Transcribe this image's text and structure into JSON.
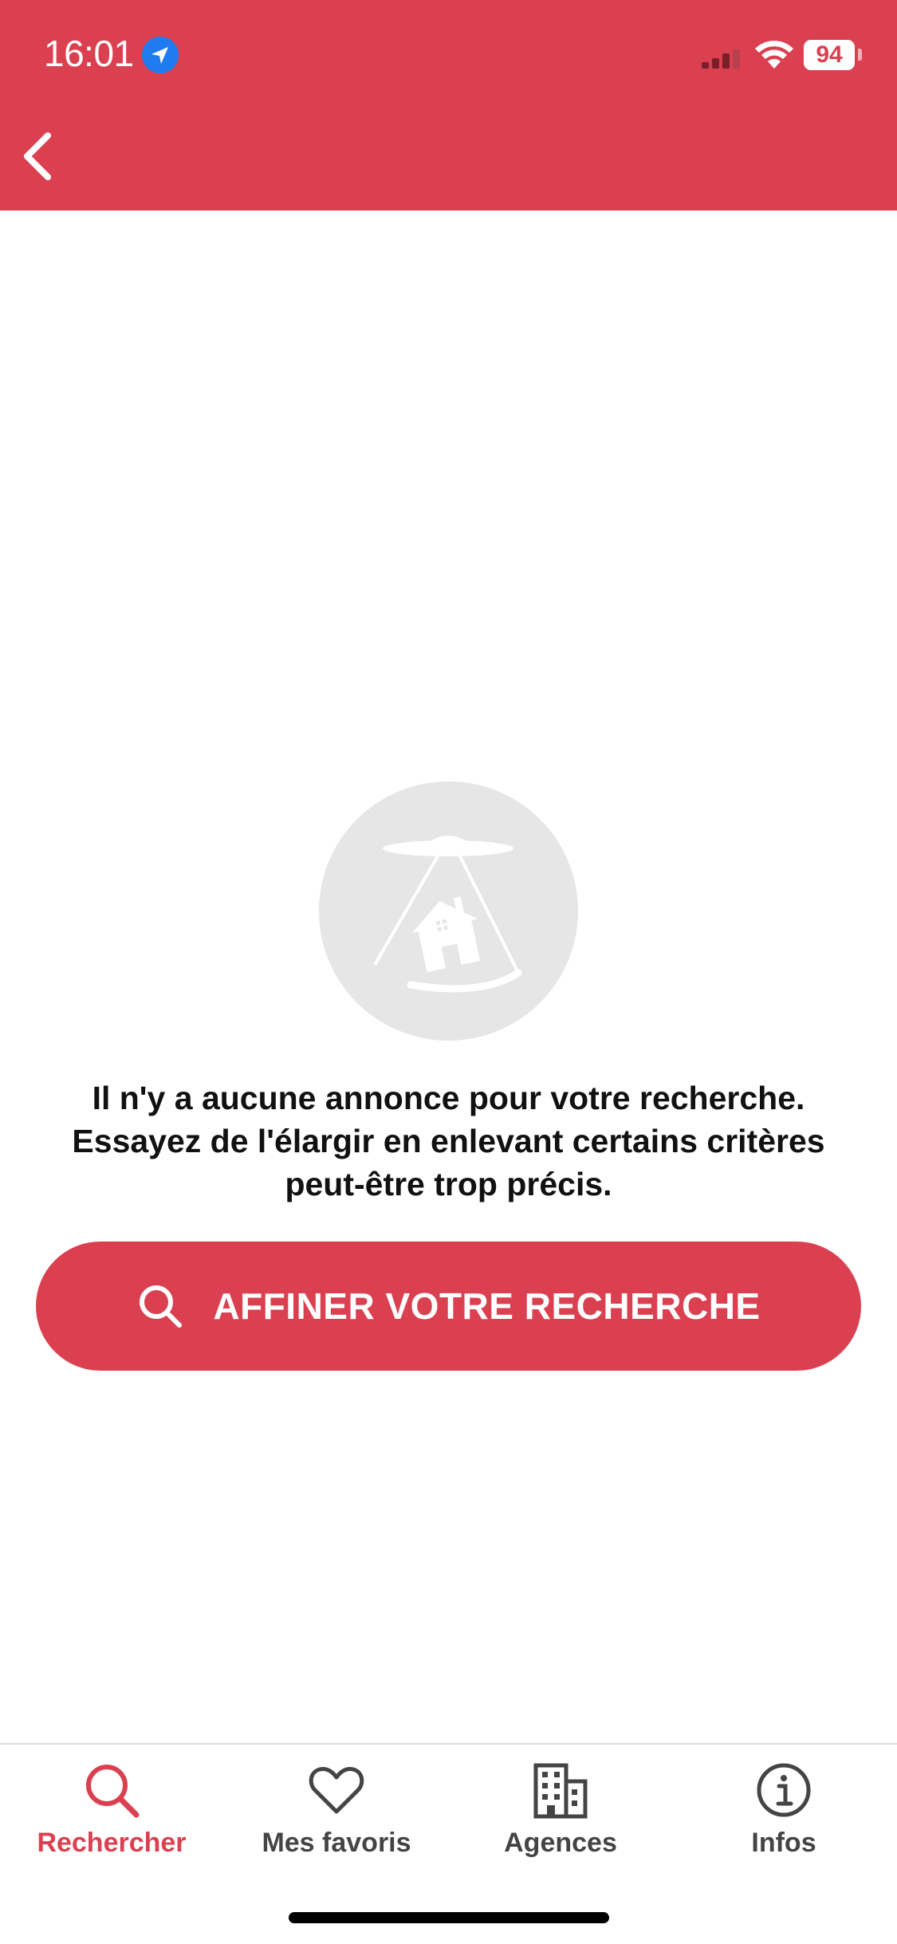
{
  "status_bar": {
    "time": "16:01",
    "battery": "94",
    "location_icon": "location-arrow-icon",
    "signal_icon": "cellular-signal-icon",
    "wifi_icon": "wifi-icon"
  },
  "header": {
    "back_icon": "chevron-left-icon",
    "background_color": "#db4050"
  },
  "empty_state": {
    "illustration": "ufo-abducting-house-icon",
    "message_lines": [
      "Il n'y a aucune annonce pour votre recherche.",
      "Essayez de l'élargir en enlevant certains critères",
      "peut-être trop précis."
    ]
  },
  "refine_button": {
    "label": "AFFINER VOTRE RECHERCHE",
    "icon": "search-icon"
  },
  "tabbar": {
    "items": [
      {
        "label": "Rechercher",
        "icon": "search-icon",
        "active": true
      },
      {
        "label": "Mes favoris",
        "icon": "heart-icon",
        "active": false
      },
      {
        "label": "Agences",
        "icon": "building-icon",
        "active": false
      },
      {
        "label": "Infos",
        "icon": "info-icon",
        "active": false
      }
    ]
  },
  "colors": {
    "accent": "#db4050",
    "tab_inactive": "#444444",
    "illustration_bg": "#e6e6e6"
  }
}
